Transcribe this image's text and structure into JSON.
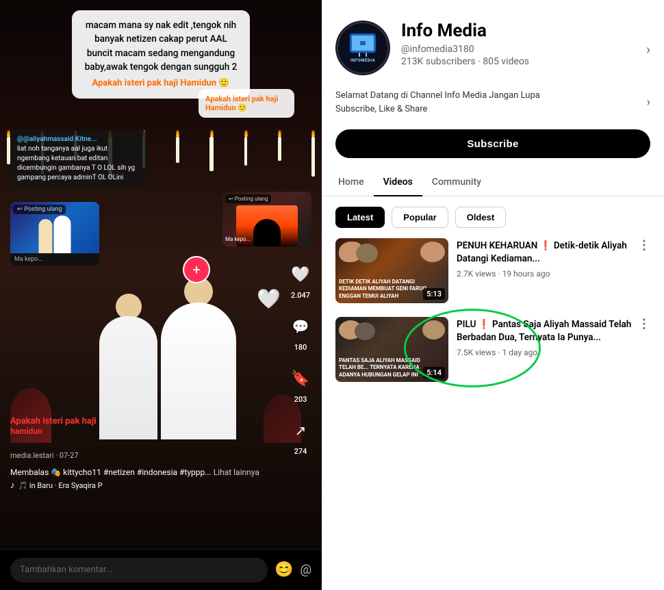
{
  "left": {
    "overlay_text": "macam mana sy nak edit ,tengok nih banyak netizen cakap perut AAL buncit macam sedang mengandung baby,awak tengok dengan sungguh 2",
    "highlight_text_1": "Apakah isteri pak haji Hamidun 🙂",
    "highlight_text_2": "Apakah isteri pak haji Hamidun 🙂",
    "repost_label": "Posting ulang",
    "repost_label2": "Posting ulang",
    "mini_author": "Ma kepo...",
    "mini_author2": "Ma kepo...",
    "comment_username": "@aliyahmassaid Kitne...",
    "comment_text": "liat noh tanganya aal juga ikut ngembang ketauan bat editan dicembungin gambanya T O LOL sih yg gampang percaya adminT OL OLini",
    "action_likes": "2.047",
    "action_comments": "180",
    "action_bookmarks": "203",
    "action_shares": "274",
    "channel_watermark": "media.lestari",
    "date_tag": "07-27",
    "hashtags": "Membalas 🎭 kittycho11 #netizen #indonesia #typpp...",
    "see_more": "Lihat lainnya",
    "music": "🎵 in Baru · Era Syaqira  P",
    "bottom_label_red": "Apakah isteri pak haji",
    "bottom_label_red2": "hamidun",
    "comment_placeholder": "Tambahkan komentar...",
    "emoji_icon": "😊",
    "at_icon": "@"
  },
  "right": {
    "channel_name": "Info Media",
    "channel_handle": "@infomedia3180",
    "channel_subscribers": "213K subscribers",
    "channel_videos": "805 videos",
    "channel_desc_line1": "Selamat Datang di Channel Info Media Jangan Lupa",
    "channel_desc_line2": "Subscribe, Like & Share",
    "subscribe_label": "Subscribe",
    "tabs": [
      {
        "label": "Home",
        "active": false
      },
      {
        "label": "Videos",
        "active": true
      },
      {
        "label": "Community",
        "active": false
      }
    ],
    "filters": [
      {
        "label": "Latest",
        "active": true
      },
      {
        "label": "Popular",
        "active": false
      },
      {
        "label": "Oldest",
        "active": false
      }
    ],
    "videos": [
      {
        "title": "PENUH KEHARUAN ❗ Detik-detik Aliyah Datangi Kediaman...",
        "thumbnail_label": "DETIK DETIK ALIYAH DATANGI KEDIAMAN MEMBUAT GENI FARUQ ENGGAN TEMUI ALIYAH",
        "duration": "5:13",
        "views": "2.7K views",
        "age": "19 hours ago",
        "more_icon": "⋮"
      },
      {
        "title": "PILU ❗ Pantas Saja Aliyah Massaid Telah Berbadan Dua, Ternyata Ia Punya...",
        "thumbnail_label": "PANTAS SAJA ALIYAH MASSAID TELAH BE... TERNYATA KARENA ADANYA HUBUNGAN GELAP INI",
        "duration": "5:14",
        "views": "7.5K views",
        "age": "1 day ago",
        "more_icon": "⋮",
        "has_green_circle": true
      }
    ]
  }
}
